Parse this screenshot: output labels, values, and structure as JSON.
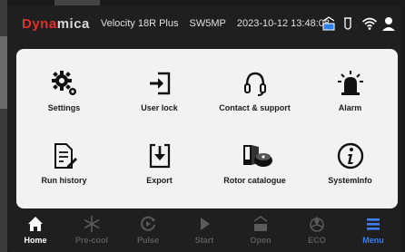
{
  "colors": {
    "brand_red": "#e0302b",
    "accent_blue": "#3e7ef0",
    "panel_bg": "#f2f2f2",
    "screen_bg": "#1f1f1f"
  },
  "header": {
    "brand_a": "Dyna",
    "brand_b": "mica",
    "model": "Velocity 18R Plus",
    "serial": "SW5MP",
    "datetime": "2023-10-12  13:48:08",
    "status_icons": [
      "lid-icon",
      "tube-icon",
      "wifi-icon",
      "user-icon"
    ]
  },
  "menu": {
    "tiles": [
      {
        "label": "Settings",
        "icon": "gears-icon"
      },
      {
        "label": "User lock",
        "icon": "login-icon"
      },
      {
        "label": "Contact & support",
        "icon": "headset-icon"
      },
      {
        "label": "Alarm",
        "icon": "siren-icon"
      },
      {
        "label": "Run history",
        "icon": "document-edit-icon"
      },
      {
        "label": "Export",
        "icon": "export-icon"
      },
      {
        "label": "Rotor catalogue",
        "icon": "rotor-catalogue-icon"
      },
      {
        "label": "SystemInfo",
        "icon": "info-icon"
      }
    ]
  },
  "nav": {
    "items": [
      {
        "label": "Home",
        "icon": "home-icon",
        "state": "active"
      },
      {
        "label": "Pre-cool",
        "icon": "snowflake-icon",
        "state": "disabled"
      },
      {
        "label": "Pulse",
        "icon": "pulse-icon",
        "state": "disabled"
      },
      {
        "label": "Start",
        "icon": "play-icon",
        "state": "disabled"
      },
      {
        "label": "Open",
        "icon": "open-lid-icon",
        "state": "disabled"
      },
      {
        "label": "ECO",
        "icon": "eco-icon",
        "state": "disabled"
      },
      {
        "label": "Menu",
        "icon": "menu-icon",
        "state": "selected"
      }
    ]
  }
}
